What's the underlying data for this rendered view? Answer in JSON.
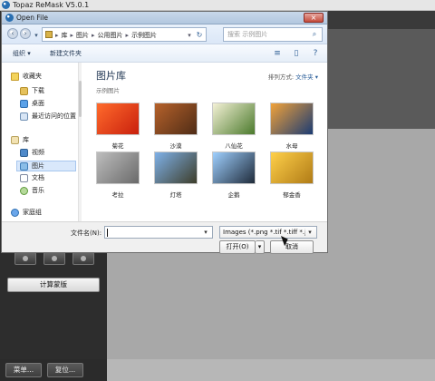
{
  "app": {
    "title": "Topaz ReMask V5.0.1",
    "buttons": {
      "compute": "计算蒙版",
      "menu": "菜单...",
      "reset": "复位..."
    }
  },
  "dialog": {
    "title": "Open File",
    "close_glyph": "×",
    "address": {
      "crumbs": [
        "库",
        "图片",
        "公用图片",
        "示例图片"
      ],
      "sep": "▸",
      "drop": "▾",
      "refresh": "↻"
    },
    "search": {
      "placeholder": "搜索 示例图片",
      "icon": "search-icon"
    },
    "toolbar": {
      "organize": "组织 ▾",
      "new_folder": "新建文件夹",
      "view_icon": "≡",
      "pane_icon": "▯",
      "help_icon": "?"
    },
    "sidebar": {
      "favorites": "收藏夹",
      "items_fav": [
        {
          "label": "下载",
          "icon": "folder-icon"
        },
        {
          "label": "桌面",
          "icon": "desktop-icon"
        },
        {
          "label": "最近访问的位置",
          "icon": "recent-icon"
        }
      ],
      "library": "库",
      "items_lib": [
        {
          "label": "视频",
          "icon": "video-icon"
        },
        {
          "label": "图片",
          "icon": "pictures-icon",
          "selected": true
        },
        {
          "label": "文档",
          "icon": "documents-icon"
        },
        {
          "label": "音乐",
          "icon": "music-icon"
        }
      ],
      "homegroup": "家庭组"
    },
    "main": {
      "title": "图片库",
      "subtitle": "示例图片",
      "sort_label": "排列方式:",
      "sort_value": "文件夹 ▾",
      "items": [
        {
          "label": "菊花",
          "colors": [
            "#ff6b2c",
            "#c9200d"
          ]
        },
        {
          "label": "沙漠",
          "colors": [
            "#b6622b",
            "#4f2c16"
          ]
        },
        {
          "label": "八仙花",
          "colors": [
            "#f4f1d6",
            "#4b7a2c"
          ]
        },
        {
          "label": "水母",
          "colors": [
            "#f1a23a",
            "#1b3b73"
          ]
        },
        {
          "label": "考拉",
          "colors": [
            "#bdbdbd",
            "#6a6a6a"
          ]
        },
        {
          "label": "灯塔",
          "colors": [
            "#7fb1e8",
            "#3d3d2a"
          ]
        },
        {
          "label": "企鹅",
          "colors": [
            "#9fd0ff",
            "#1f2b3a"
          ]
        },
        {
          "label": "郁金香",
          "colors": [
            "#ffd04a",
            "#b07b16"
          ]
        }
      ]
    },
    "footer": {
      "filename_label": "文件名(N):",
      "filename_value": "",
      "filter": "Images (*.png *.tif *.tiff *.jpg",
      "open": "打开(O)",
      "open_drop": "▾",
      "cancel": "取消"
    }
  }
}
